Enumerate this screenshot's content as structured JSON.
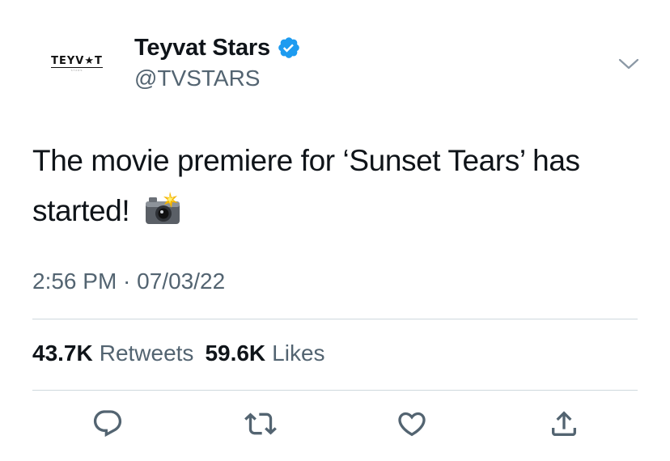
{
  "account": {
    "display_name": "Teyvat Stars",
    "handle": "@TVSTARS",
    "logo_text": "TEYV★T",
    "logo_subtext": "STARS",
    "verified": true
  },
  "tweet": {
    "text": "The movie premiere for ‘Sunset Tears’ has started!",
    "emoji": "camera-with-flash",
    "timestamp": "2:56 PM · 07/03/22"
  },
  "stats": {
    "retweets_count": "43.7K",
    "retweets_label": "Retweets",
    "likes_count": "59.6K",
    "likes_label": "Likes"
  },
  "actions": {
    "reply_icon": "reply-icon",
    "retweet_icon": "retweet-icon",
    "like_icon": "heart-icon",
    "share_icon": "share-icon"
  },
  "colors": {
    "text_primary": "#0f1419",
    "text_secondary": "#536471",
    "verified_blue": "#1d9bf0",
    "divider": "#cfd9de"
  }
}
